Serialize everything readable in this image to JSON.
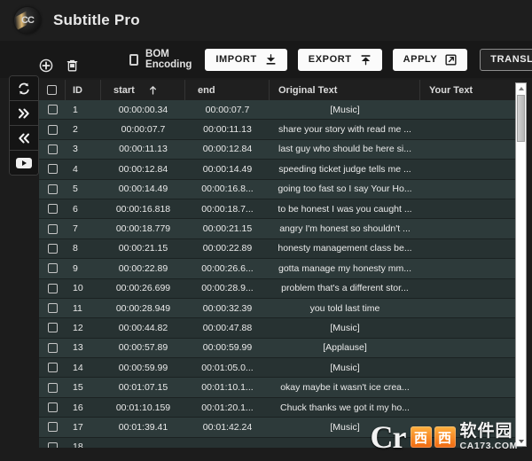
{
  "window": {
    "title": "Subtitle Pro",
    "logo_icon": "cc-logo-icon"
  },
  "toolbar": {
    "bom_label": "BOM Encoding",
    "bom_checked": false,
    "import_label": "IMPORT",
    "import_icon": "download-icon",
    "export_label": "EXPORT",
    "export_icon": "upload-icon",
    "apply_label": "APPLY",
    "apply_icon": "external-link-icon",
    "translator_label": "TRANSLATOR",
    "accent_light": "#fbfbfb",
    "accent_dark": "#242424"
  },
  "rail": {
    "items": [
      {
        "name": "sync-icon"
      },
      {
        "name": "chevron-double-right-icon"
      },
      {
        "name": "chevron-double-left-icon"
      },
      {
        "name": "youtube-icon"
      }
    ]
  },
  "table_actions": {
    "add_icon": "plus-circle-icon",
    "delete_icon": "trash-icon"
  },
  "table": {
    "sort_column": "start",
    "sort_direction": "asc",
    "sort_icon": "arrow-up-icon",
    "columns": [
      {
        "key": "check",
        "label": ""
      },
      {
        "key": "id",
        "label": "ID"
      },
      {
        "key": "start",
        "label": "start"
      },
      {
        "key": "end",
        "label": "end"
      },
      {
        "key": "original",
        "label": "Original Text"
      },
      {
        "key": "your",
        "label": "Your Text"
      }
    ],
    "rows": [
      {
        "id": "1",
        "start": "00:00:00.34",
        "end": "00:00:07.7",
        "original": "[Music]",
        "your": ""
      },
      {
        "id": "2",
        "start": "00:00:07.7",
        "end": "00:00:11.13",
        "original": "share your story with read me ...",
        "your": ""
      },
      {
        "id": "3",
        "start": "00:00:11.13",
        "end": "00:00:12.84",
        "original": "last guy who should be here si...",
        "your": ""
      },
      {
        "id": "4",
        "start": "00:00:12.84",
        "end": "00:00:14.49",
        "original": "speeding ticket judge tells me ...",
        "your": ""
      },
      {
        "id": "5",
        "start": "00:00:14.49",
        "end": "00:00:16.8...",
        "original": "going too fast so I say Your Ho...",
        "your": ""
      },
      {
        "id": "6",
        "start": "00:00:16.818",
        "end": "00:00:18.7...",
        "original": "to be honest I was you caught ...",
        "your": ""
      },
      {
        "id": "7",
        "start": "00:00:18.779",
        "end": "00:00:21.15",
        "original": "angry I'm honest so shouldn't ...",
        "your": ""
      },
      {
        "id": "8",
        "start": "00:00:21.15",
        "end": "00:00:22.89",
        "original": "honesty management class be...",
        "your": ""
      },
      {
        "id": "9",
        "start": "00:00:22.89",
        "end": "00:00:26.6...",
        "original": "gotta manage my honesty mm...",
        "your": ""
      },
      {
        "id": "10",
        "start": "00:00:26.699",
        "end": "00:00:28.9...",
        "original": "problem that's a different stor...",
        "your": ""
      },
      {
        "id": "11",
        "start": "00:00:28.949",
        "end": "00:00:32.39",
        "original": "you told last time",
        "your": ""
      },
      {
        "id": "12",
        "start": "00:00:44.82",
        "end": "00:00:47.88",
        "original": "[Music]",
        "your": ""
      },
      {
        "id": "13",
        "start": "00:00:57.89",
        "end": "00:00:59.99",
        "original": "[Applause]",
        "your": ""
      },
      {
        "id": "14",
        "start": "00:00:59.99",
        "end": "00:01:05.0...",
        "original": "[Music]",
        "your": ""
      },
      {
        "id": "15",
        "start": "00:01:07.15",
        "end": "00:01:10.1...",
        "original": "okay maybe it wasn't ice crea...",
        "your": ""
      },
      {
        "id": "16",
        "start": "00:01:10.159",
        "end": "00:01:20.1...",
        "original": "Chuck thanks we got it my ho...",
        "your": ""
      },
      {
        "id": "17",
        "start": "00:01:39.41",
        "end": "00:01:42.24",
        "original": "[Music]",
        "your": ""
      },
      {
        "id": "18",
        "start": "",
        "end": "",
        "original": "",
        "your": ""
      }
    ]
  },
  "scrollbar": {
    "up_icon": "caret-up-icon",
    "down_icon": "caret-down-icon"
  },
  "watermark": {
    "cr": "Cr",
    "badge1": "西",
    "badge2": "西",
    "cn": "软件园",
    "url": "CA173.COM"
  }
}
